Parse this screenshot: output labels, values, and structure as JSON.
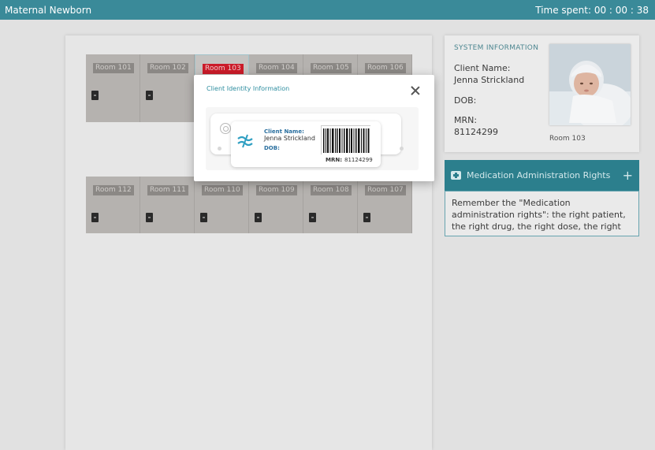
{
  "app": {
    "title": "Maternal Newborn",
    "timer_label": "Time spent: 00 : 00 : 38"
  },
  "rooms_top": [
    "Room 101",
    "Room 102",
    "Room 103",
    "Room 104",
    "Room 105",
    "Room 106"
  ],
  "rooms_bottom": [
    "Room 112",
    "Room 111",
    "Room 110",
    "Room 109",
    "Room 108",
    "Room 107"
  ],
  "selected_room": "Room 103",
  "system_info": {
    "title": "SYSTEM INFORMATION",
    "client_name_label": "Client Name:",
    "client_name": "Jenna Strickland",
    "dob_label": "DOB:",
    "mrn_label": "MRN:",
    "mrn": "81124299",
    "photo_caption": "Room 103"
  },
  "medication_panel": {
    "title": "Medication Administration Rights",
    "expand_glyph": "+",
    "body": "Remember the \"Medication administration rights\": the right patient, the right drug, the right dose, the right"
  },
  "modal": {
    "title": "Client Identity Information",
    "band": {
      "name_label": "Client Name:",
      "name": "Jenna Strickland",
      "dob_label": "DOB:",
      "mrn_label": "MRN:",
      "mrn": "81124299"
    }
  },
  "colors": {
    "header": "#3a8a99",
    "accent": "#2d8290",
    "room_highlight": "#d01c2a"
  }
}
